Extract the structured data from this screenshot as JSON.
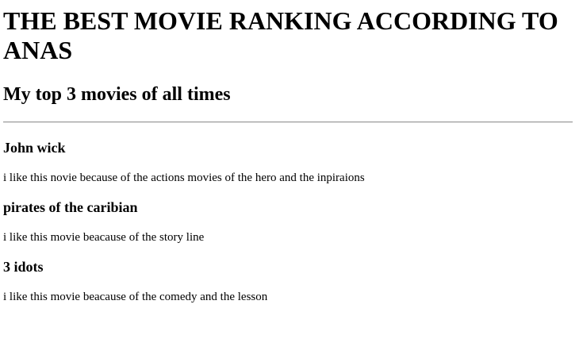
{
  "page": {
    "title": "THE BEST MOVIE RANKING ACCORDING TO ANAS",
    "subtitle": "My top 3 movies of all times"
  },
  "movies": [
    {
      "name": "John wick",
      "reason": "i like this novie because of the actions movies of the hero and the inpiraions"
    },
    {
      "name": "pirates of the caribian",
      "reason": "i like this movie beacause of the story line"
    },
    {
      "name": "3 idots",
      "reason": "i like this movie beacause of the comedy and the lesson"
    }
  ]
}
